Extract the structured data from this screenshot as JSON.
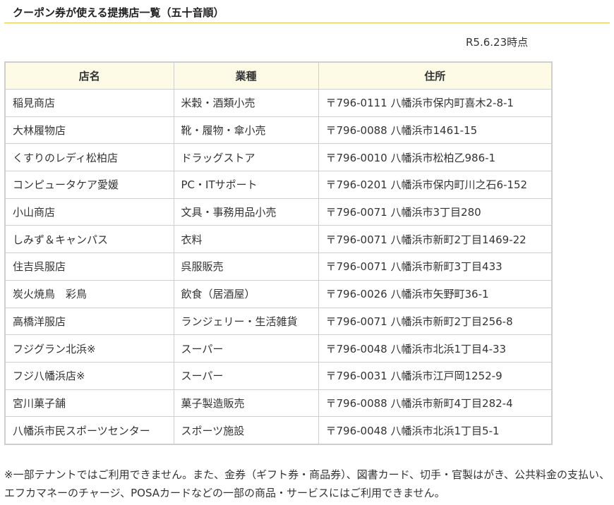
{
  "heading": "クーポン券が使える提携店一覧（五十音順）",
  "as_of": "R5.6.23時点",
  "columns": [
    "店名",
    "業種",
    "住所"
  ],
  "rows": [
    [
      "稲見商店",
      "米穀・酒類小売",
      "〒796-0111 八幡浜市保内町喜木2-8-1"
    ],
    [
      "大林履物店",
      "靴・履物・傘小売",
      "〒796-0088 八幡浜市1461-15"
    ],
    [
      "くすりのレディ松柏店",
      "ドラッグストア",
      "〒796-0010 八幡浜市松柏乙986-1"
    ],
    [
      "コンピュータケア愛媛",
      "PC・ITサポート",
      "〒796-0201 八幡浜市保内町川之石6-152"
    ],
    [
      "小山商店",
      "文具・事務用品小売",
      "〒796-0071 八幡浜市3丁目280"
    ],
    [
      "しみず＆キャンパス",
      "衣料",
      "〒796-0071 八幡浜市新町2丁目1469-22"
    ],
    [
      "住吉呉服店",
      "呉服販売",
      "〒796-0071 八幡浜市新町3丁目433"
    ],
    [
      "炭火焼鳥　彩鳥",
      "飲食（居酒屋）",
      "〒796-0026 八幡浜市矢野町36-1"
    ],
    [
      "高橋洋服店",
      "ランジェリー・生活雑貨",
      "〒796-0071 八幡浜市新町2丁目256-8"
    ],
    [
      "フジグラン北浜※",
      "スーパー",
      "〒796-0048 八幡浜市北浜1丁目4-33"
    ],
    [
      "フジ八幡浜店※",
      "スーパー",
      "〒796-0031 八幡浜市江戸岡1252-9"
    ],
    [
      "宮川菓子舗",
      "菓子製造販売",
      "〒796-0088 八幡浜市新町4丁目282-4"
    ],
    [
      "八幡浜市民スポーツセンター",
      "スポーツ施設",
      "〒796-0048 八幡浜市北浜1丁目5-1"
    ]
  ],
  "note": "※一部テナントではご利用できません。また、金券（ギフト券・商品券）、図書カード、切手・官製はがき、公共料金の支払い、エフカマネーのチャージ、POSAカードなどの一部の商品・サービスにはご利用できません。",
  "colors": {
    "heading_rule": "#e3c54a",
    "header_bg": "#fdfae6",
    "border": "#cfcfcf"
  }
}
